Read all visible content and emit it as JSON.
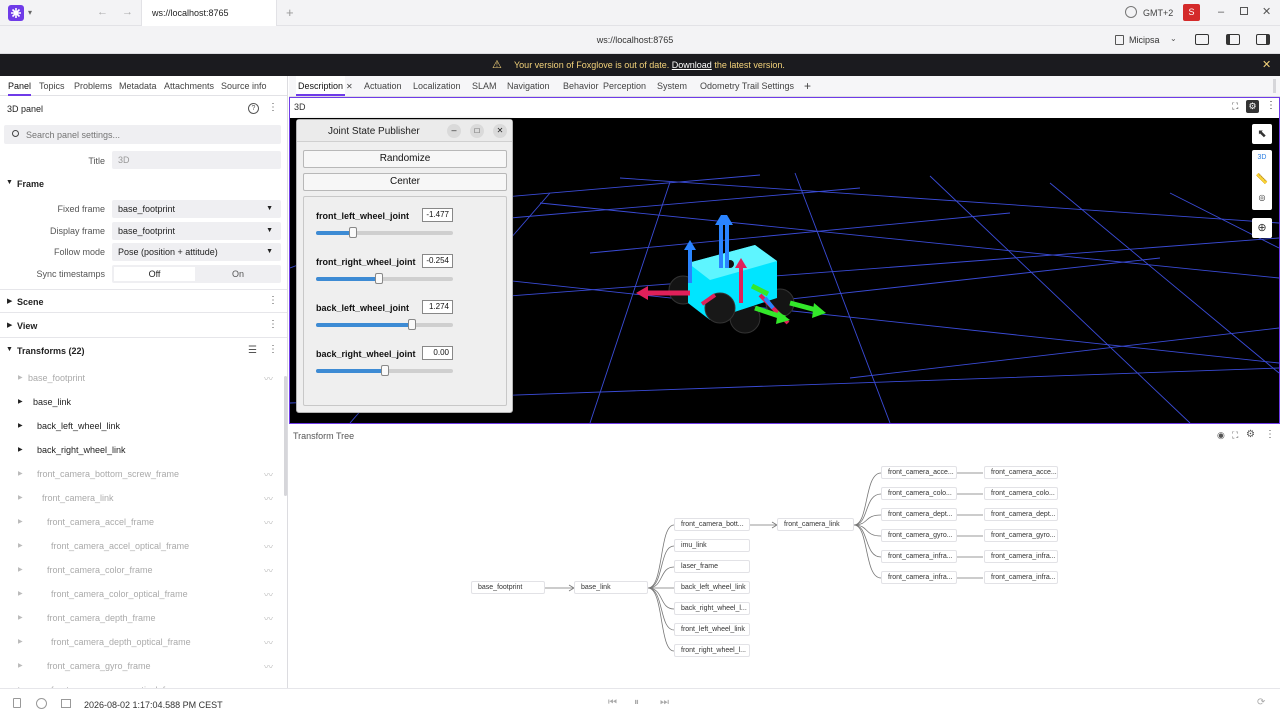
{
  "titlebar": {
    "tab_title": "ws://localhost:8765",
    "timezone": "GMT+2",
    "user_initial": "S"
  },
  "urlbar": {
    "url": "ws://localhost:8765",
    "user_name": "Micipsa"
  },
  "banner": {
    "text_before": "Your version of Foxglove is out of date.",
    "link": "Download",
    "text_after": "the latest version."
  },
  "sidebar": {
    "tabs": [
      "Panel",
      "Topics",
      "Problems",
      "Metadata",
      "Attachments",
      "Source info"
    ],
    "panel_title": "3D panel",
    "search_placeholder": "Search panel settings...",
    "title_label": "Title",
    "title_value": "3D",
    "frame_section": "Frame",
    "fixed_frame_label": "Fixed frame",
    "fixed_frame_value": "base_footprint",
    "display_frame_label": "Display frame",
    "display_frame_value": "base_footprint",
    "follow_mode_label": "Follow mode",
    "follow_mode_value": "Pose (position + attitude)",
    "sync_label": "Sync timestamps",
    "sync_off": "Off",
    "sync_on": "On",
    "scene_section": "Scene",
    "view_section": "View",
    "transforms_section": "Transforms (22)",
    "transforms": [
      "base_footprint",
      "base_link",
      "back_left_wheel_link",
      "back_right_wheel_link",
      "front_camera_bottom_screw_frame",
      "front_camera_link",
      "front_camera_accel_frame",
      "front_camera_accel_optical_frame",
      "front_camera_color_frame",
      "front_camera_color_optical_frame",
      "front_camera_depth_frame",
      "front_camera_depth_optical_frame",
      "front_camera_gyro_frame",
      "front_camera_gyro_optical_frame"
    ]
  },
  "main": {
    "tabs": [
      "Description",
      "Actuation",
      "Localization",
      "SLAM",
      "Navigation",
      "Behavior",
      "Perception",
      "System",
      "Odometry Trail Settings"
    ],
    "panel_3d_title": "3D",
    "view_mode": "3D",
    "transform_tree_title": "Transform Tree"
  },
  "joint_state_publisher": {
    "title": "Joint State Publisher",
    "randomize": "Randomize",
    "center": "Center",
    "joints": [
      {
        "name": "front_left_wheel_joint",
        "value": "-1.477",
        "fraction": 0.27
      },
      {
        "name": "front_right_wheel_joint",
        "value": "-0.254",
        "fraction": 0.46
      },
      {
        "name": "back_left_wheel_joint",
        "value": "1.274",
        "fraction": 0.7
      },
      {
        "name": "back_right_wheel_joint",
        "value": "0.00",
        "fraction": 0.5
      }
    ]
  },
  "transform_tree": {
    "nodes": [
      "base_footprint",
      "base_link",
      "front_camera_bott...",
      "imu_link",
      "laser_frame",
      "back_left_wheel_link",
      "back_right_wheel_l...",
      "front_left_wheel_link",
      "front_right_wheel_l...",
      "front_camera_link",
      "front_camera_acce...",
      "front_camera_colo...",
      "front_camera_dept...",
      "front_camera_gyro...",
      "front_camera_infra...",
      "front_camera_infra...",
      "front_camera_acce...",
      "front_camera_colo...",
      "front_camera_dept...",
      "front_camera_gyro...",
      "front_camera_infra...",
      "front_camera_infra..."
    ]
  },
  "footer": {
    "timestamp": "2026-08-02 1:17:04.588 PM CEST"
  },
  "colors": {
    "accent": "#6f3be8",
    "banner_bg": "#1b1b1f",
    "banner_text": "#f3d27a",
    "user_badge": "#d42a2a",
    "robot_body": "#00e5ff",
    "grid": "#3a4bd6"
  }
}
